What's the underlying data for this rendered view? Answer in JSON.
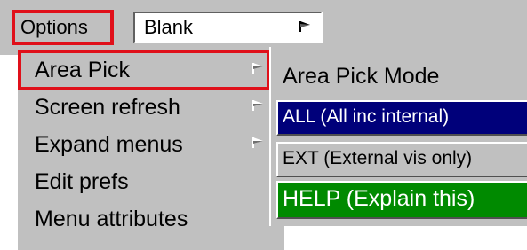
{
  "toolbar": {
    "options_label": "Options",
    "display_value": "Blank"
  },
  "menu": {
    "items": [
      {
        "label": "Area Pick",
        "has_submenu": true,
        "highlighted": true
      },
      {
        "label": "Screen refresh",
        "has_submenu": true
      },
      {
        "label": "Expand menus",
        "has_submenu": true
      },
      {
        "label": "Edit prefs",
        "has_submenu": false
      },
      {
        "label": "Menu attributes",
        "has_submenu": false
      }
    ]
  },
  "submenu": {
    "title": "Area Pick Mode",
    "options": [
      {
        "label": "ALL  (All inc internal)",
        "selected": true,
        "color": "#00007a"
      },
      {
        "label": "EXT  (External vis only)",
        "selected": false,
        "color": "#c0c0c0"
      },
      {
        "label": "HELP (Explain this)",
        "selected": false,
        "color": "#008a00"
      }
    ]
  },
  "icons": {
    "submenu_arrow": "flag-arrow-icon"
  },
  "colors": {
    "highlight_border": "#e0101a",
    "menu_background": "#c0c0c0",
    "selected_option": "#00007a",
    "help_option": "#008a00"
  }
}
